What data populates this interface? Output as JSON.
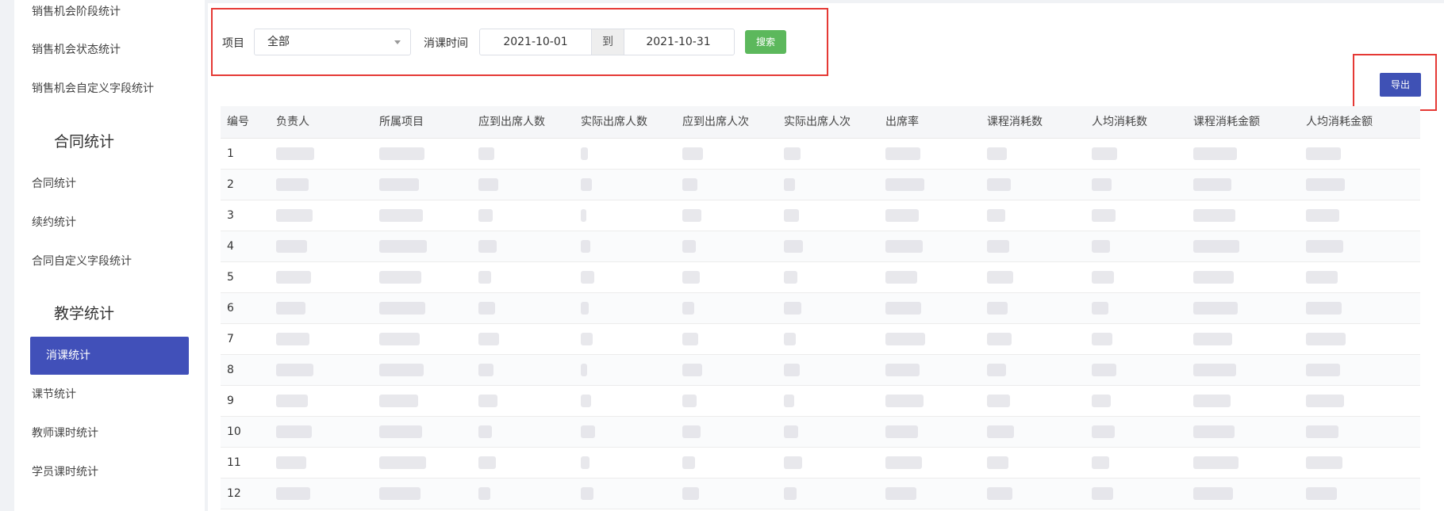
{
  "sidebar": {
    "items": [
      {
        "label": "销售机会阶段统计"
      },
      {
        "label": "销售机会状态统计"
      },
      {
        "label": "销售机会自定义字段统计"
      }
    ],
    "groups": [
      {
        "title": "合同统计",
        "items": [
          {
            "label": "合同统计"
          },
          {
            "label": "续约统计"
          },
          {
            "label": "合同自定义字段统计"
          }
        ]
      },
      {
        "title": "教学统计",
        "items": [
          {
            "label": "消课统计",
            "active": true
          },
          {
            "label": "课节统计"
          },
          {
            "label": "教师课时统计"
          },
          {
            "label": "学员课时统计"
          }
        ]
      }
    ]
  },
  "filters": {
    "project_label": "项目",
    "project_value": "全部",
    "time_label": "消课时间",
    "date_from": "2021-10-01",
    "date_sep": "到",
    "date_to": "2021-10-31",
    "search_label": "搜索"
  },
  "export_label": "导出",
  "table": {
    "columns": [
      "编号",
      "负责人",
      "所属项目",
      "应到出席人数",
      "实际出席人数",
      "应到出席人次",
      "实际出席人次",
      "出席率",
      "课程消耗数",
      "人均消耗数",
      "课程消耗金额",
      "人均消耗金额"
    ],
    "rows": [
      "1",
      "2",
      "3",
      "4",
      "5",
      "6",
      "7",
      "8",
      "9",
      "10",
      "11",
      "12"
    ]
  },
  "colors": {
    "accent": "#3f51b5",
    "search": "#5cb85c",
    "highlight": "#e53935"
  }
}
